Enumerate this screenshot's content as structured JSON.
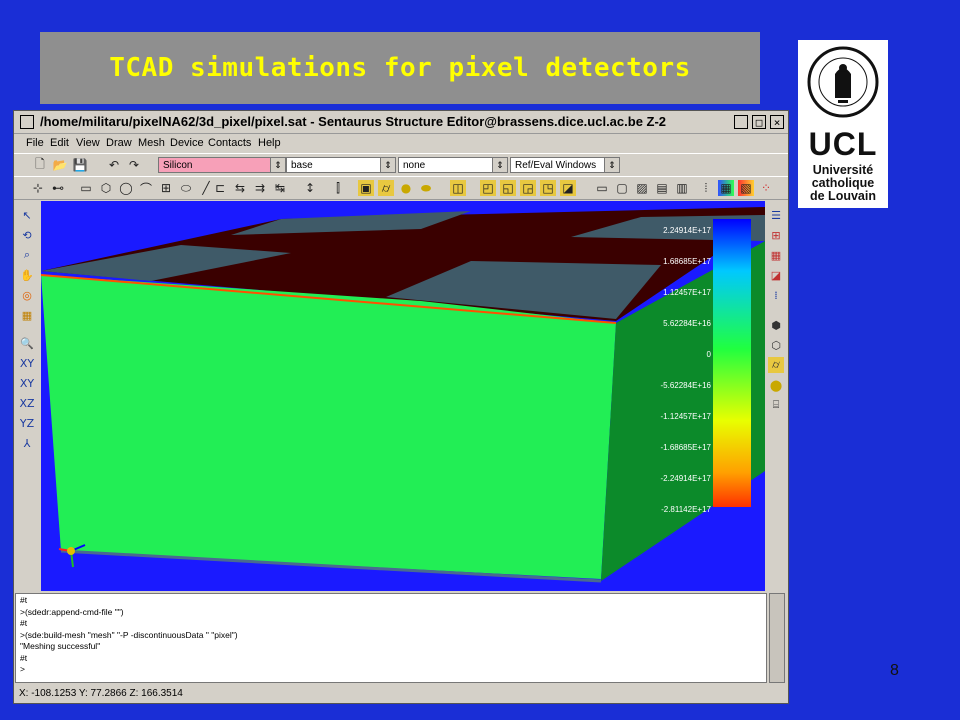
{
  "slide": {
    "title": "TCAD simulations for pixel detectors",
    "page_number": "8"
  },
  "logo": {
    "acronym": "UCL",
    "line1": "Université",
    "line2": "catholique",
    "line3": "de Louvain",
    "seal_text": "UNIVERSITAS CATHOLICA LOVANIENSIS 1425"
  },
  "window": {
    "title": "/home/militaru/pixelNA62/3d_pixel/pixel.sat - Sentaurus Structure Editor@brassens.dice.ucl.ac.be Z-2",
    "menu": [
      "File",
      "Edit",
      "View",
      "Draw",
      "Mesh",
      "Device",
      "Contacts",
      "Help"
    ],
    "combos": {
      "material": "Silicon",
      "region": "base",
      "mode": "none",
      "window": "Ref/Eval Windows"
    }
  },
  "legend": {
    "values": [
      "2.24914E+17",
      "1.68685E+17",
      "1.12457E+17",
      "5.62284E+16",
      "0",
      "-5.62284E+16",
      "-1.12457E+17",
      "-1.68685E+17",
      "-2.24914E+17",
      "-2.81142E+17"
    ]
  },
  "console": {
    "lines": [
      "#t",
      ">(sdedr:append-cmd-file \"\")",
      "#t",
      ">(sde:build-mesh \"mesh\" \"-P -discontinuousData \" \"pixel\")",
      "\"Meshing successful\"",
      "#t",
      ">"
    ]
  },
  "status": {
    "coords": "X: -108.1253 Y: 77.2866 Z: 166.3514"
  },
  "colors": {
    "slide_bg": "#1a2ed6",
    "title_text": "#ffff00",
    "silicon_green": "#22ee55",
    "implant_dark_red": "#3a0000",
    "metal_slate": "#3f5a68"
  }
}
